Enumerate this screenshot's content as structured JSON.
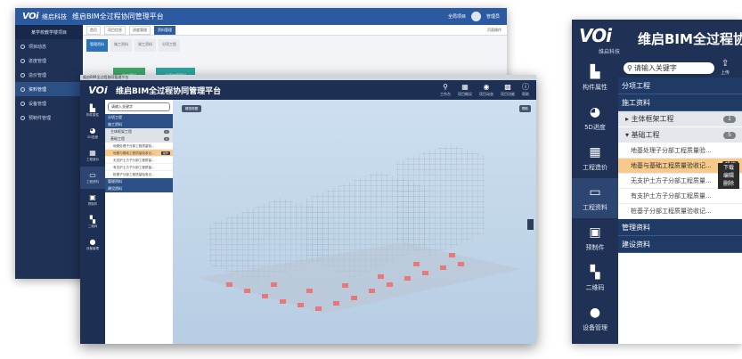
{
  "back_window": {
    "logo": "VOi",
    "company": "维启科技",
    "platform": "维启BIM全过程协同管理平台",
    "header_right": [
      "全局项目",
      "管理员"
    ],
    "project_name": "某学校教学楼项目",
    "nav": [
      {
        "label": "项目动态",
        "icon": "circle-icon"
      },
      {
        "label": "进度管理",
        "icon": "clock-icon"
      },
      {
        "label": "造价管理",
        "icon": "money-icon"
      },
      {
        "label": "资料管理",
        "icon": "folder-icon"
      },
      {
        "label": "设备管理",
        "icon": "device-icon"
      },
      {
        "label": "预制件管理",
        "icon": "component-icon"
      }
    ],
    "tabs": [
      "首页",
      "项目信息",
      "进度管理",
      "资料管理"
    ],
    "tabs_right": "页面操作",
    "subtabs": [
      "管理资料",
      "施工资料",
      "竣工资料",
      "分项工程"
    ],
    "cards": [
      "施工资料",
      "分项工程资料"
    ]
  },
  "front_window": {
    "title_bar": "维启BIM全过程协同管理平台",
    "logo": "VOi",
    "platform": "维启BIM全过程协同管理平台",
    "tools": [
      {
        "label": "工作台",
        "icon": "person-icon"
      },
      {
        "label": "项目概况",
        "icon": "building-icon"
      },
      {
        "label": "项目动态",
        "icon": "target-icon"
      },
      {
        "label": "项目功能",
        "icon": "grid-icon"
      },
      {
        "label": "帮助",
        "icon": "info-icon"
      }
    ],
    "side": [
      {
        "label": "构件属性",
        "icon": "bars-icon"
      },
      {
        "label": "5D进度",
        "icon": "pie-icon"
      },
      {
        "label": "工程造价",
        "icon": "calculator-icon"
      },
      {
        "label": "工程资料",
        "icon": "folder-icon"
      },
      {
        "label": "预制件",
        "icon": "precast-icon"
      },
      {
        "label": "二维码",
        "icon": "qr-icon"
      },
      {
        "label": "设备管理",
        "icon": "info-icon"
      }
    ],
    "search_placeholder": "请输入关键字",
    "sections": [
      "分项工程",
      "施工资料"
    ],
    "sub1": "主体框架工程",
    "sub1_count": "1",
    "sub2": "基础工程",
    "sub2_count": "5",
    "leaves": [
      "地基处理子分部工程质量验...",
      "地基与基础工程质量验收记...",
      "无支护土方子分部工程质量...",
      "有支护土方子分部工程质量...",
      "桩基子分部工程质量验收记..."
    ],
    "op_label": "操作",
    "bottom_sections": [
      "管理资料",
      "建设资料"
    ],
    "view_button": "模型视图",
    "help_button": "帮助"
  },
  "panel": {
    "logo": "VOi",
    "company": "维启科技",
    "platform": "维启BIM全过程协",
    "search_placeholder": "请输入关键字",
    "upload_label": "上传",
    "side": [
      {
        "label": "构件属性",
        "icon": "bars-icon"
      },
      {
        "label": "5D进度",
        "icon": "pie-icon"
      },
      {
        "label": "工程造价",
        "icon": "calculator-icon"
      },
      {
        "label": "工程资料",
        "icon": "folder-icon"
      },
      {
        "label": "预制件",
        "icon": "precast-icon"
      },
      {
        "label": "二维码",
        "icon": "qr-icon"
      },
      {
        "label": "设备管理",
        "icon": "info-icon"
      }
    ],
    "section1": "分项工程",
    "section2": "施工资料",
    "sub1": "主体框架工程",
    "sub1_count": "1",
    "sub2": "基础工程",
    "sub2_count": "5",
    "leaves": [
      "地基处理子分部工程质量验...",
      "地基与基础工程质量验收记...",
      "无支护土方子分部工程质量...",
      "有支护土方子分部工程质量...",
      "桩基子分部工程质量验收记..."
    ],
    "op_label": "操作",
    "menu": [
      "下载",
      "编辑",
      "删除"
    ],
    "section3": "管理资料",
    "section4": "建设资料"
  }
}
